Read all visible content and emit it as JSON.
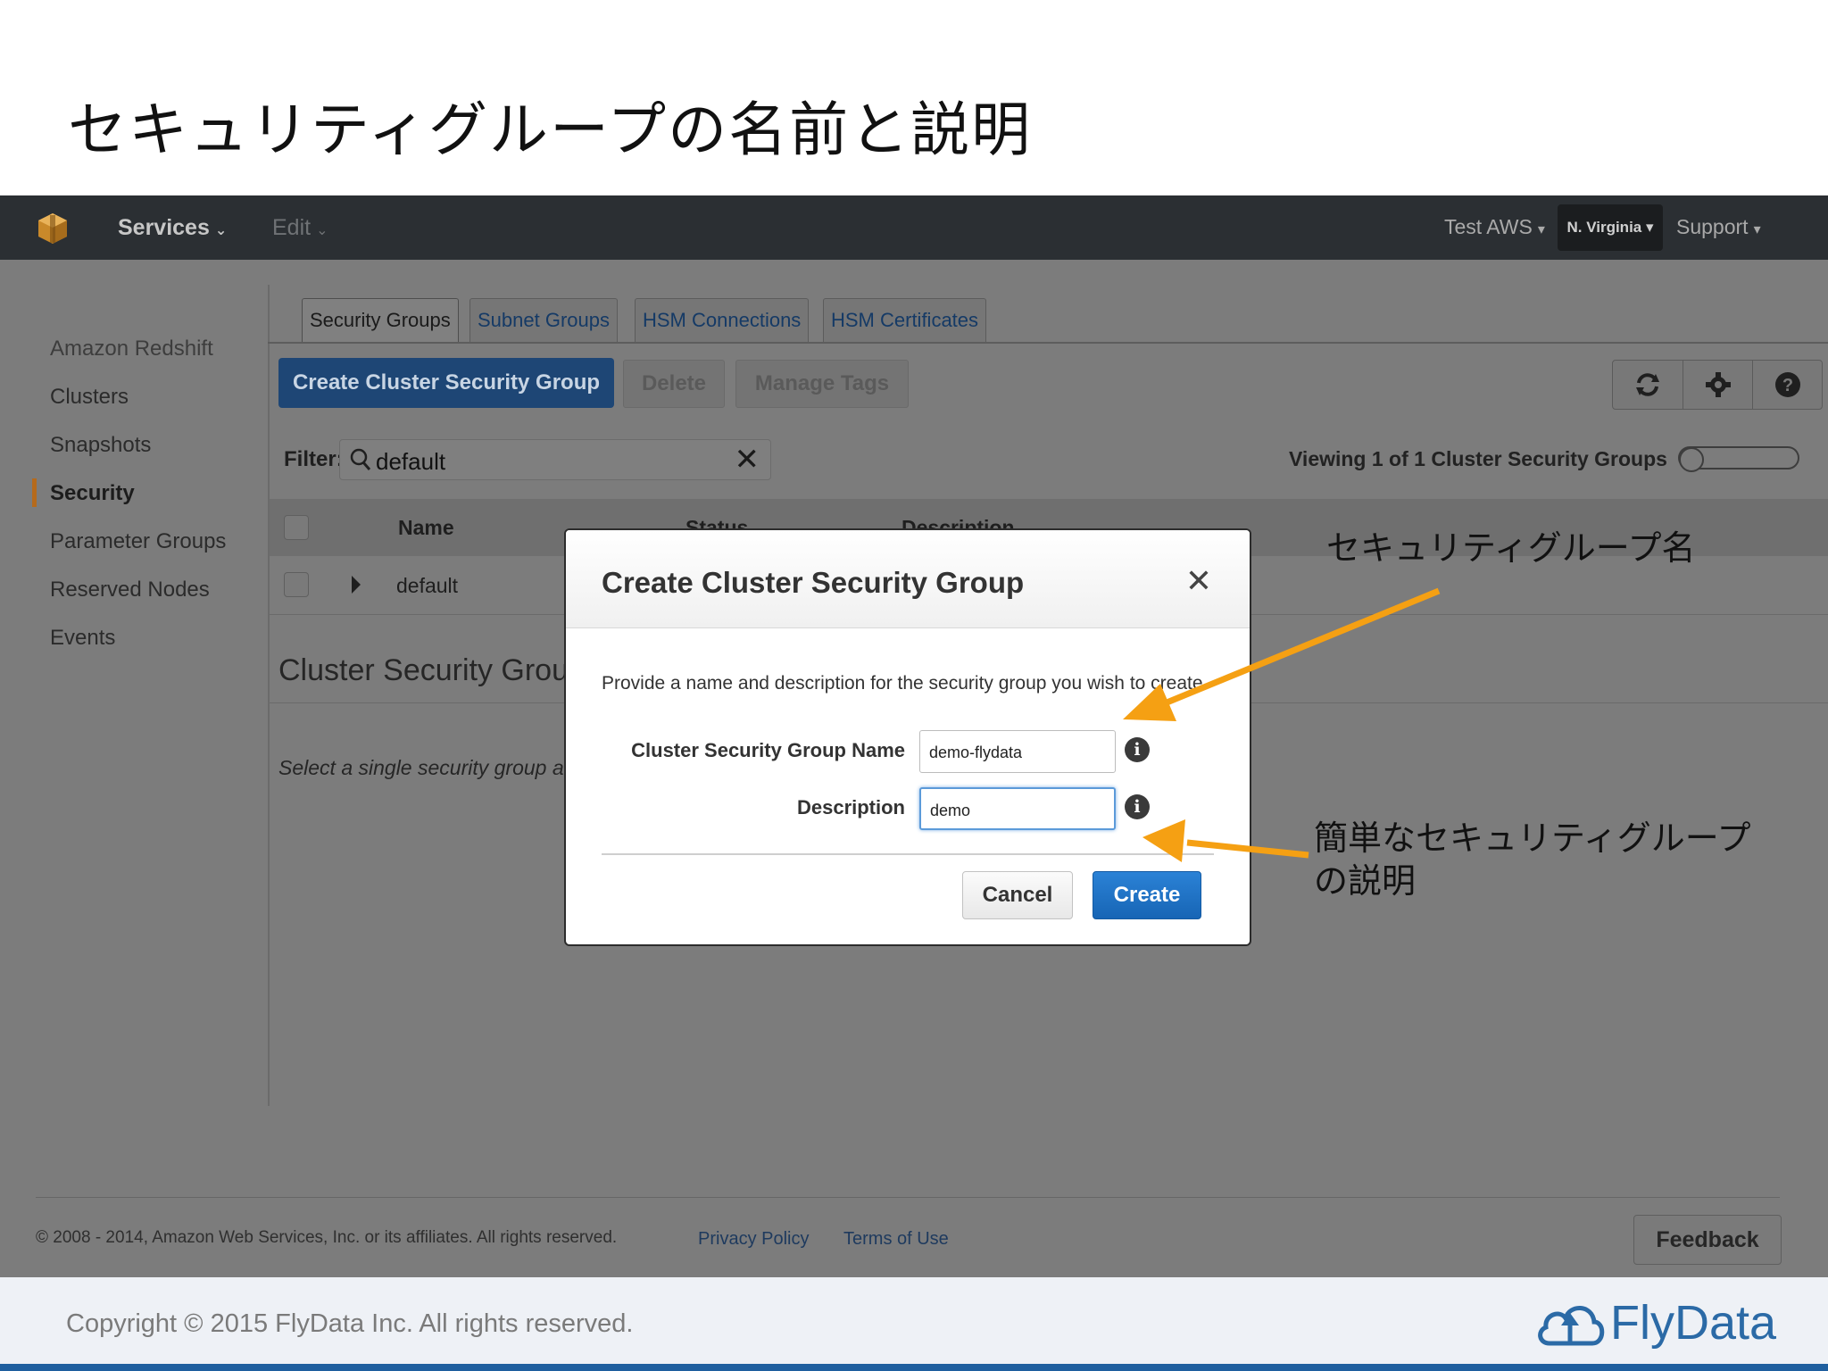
{
  "slide": {
    "title": "セキュリティグループの名前と説明",
    "copyright": "Copyright © 2015 FlyData Inc. All rights reserved.",
    "brand": "FlyData"
  },
  "topbar": {
    "services_label": "Services",
    "edit_label": "Edit",
    "account_label": "Test AWS",
    "region_label": "N. Virginia",
    "support_label": "Support"
  },
  "sidebar": {
    "items": [
      {
        "label": "Amazon Redshift"
      },
      {
        "label": "Clusters"
      },
      {
        "label": "Snapshots"
      },
      {
        "label": "Security"
      },
      {
        "label": "Parameter Groups"
      },
      {
        "label": "Reserved Nodes"
      },
      {
        "label": "Events"
      }
    ],
    "active_index": 3
  },
  "tabs": [
    {
      "label": "Security Groups"
    },
    {
      "label": "Subnet Groups"
    },
    {
      "label": "HSM Connections"
    },
    {
      "label": "HSM Certificates"
    }
  ],
  "toolbar": {
    "create_label": "Create Cluster Security Group",
    "delete_label": "Delete",
    "manage_tags_label": "Manage Tags",
    "icons": [
      "refresh-icon",
      "gear-icon",
      "help-icon"
    ]
  },
  "filter": {
    "label": "Filter:",
    "value": "default",
    "viewing_text": "Viewing 1 of 1 Cluster Security Groups"
  },
  "table": {
    "columns": [
      "Name",
      "Status",
      "Description"
    ],
    "rows": [
      {
        "name": "default"
      }
    ]
  },
  "detail": {
    "title": "Cluster Security Grou",
    "hint": "Select a single security group ab"
  },
  "footer": {
    "copyright": "© 2008 - 2014, Amazon Web Services, Inc. or its affiliates. All rights reserved.",
    "privacy_label": "Privacy Policy",
    "terms_label": "Terms of Use",
    "feedback_label": "Feedback"
  },
  "modal": {
    "title": "Create Cluster Security Group",
    "description": "Provide a name and description for the security group you wish to create.",
    "name_label": "Cluster Security Group Name",
    "name_value": "demo-flydata",
    "description_label": "Description",
    "description_value": "demo",
    "cancel_label": "Cancel",
    "create_label": "Create"
  },
  "annotations": {
    "name_note": "セキュリティグループ名",
    "desc_note_line1": "簡単なセキュリティグループ",
    "desc_note_line2": "の説明",
    "arrow_color": "#f5a013"
  }
}
